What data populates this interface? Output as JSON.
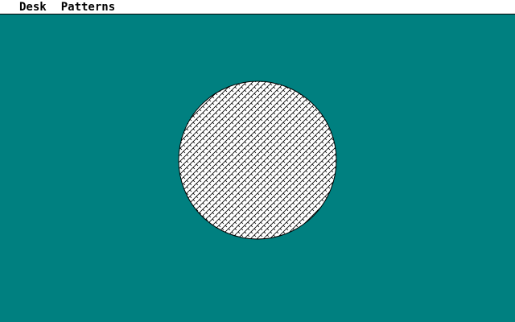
{
  "menubar": {
    "items": [
      {
        "label": "Desk"
      },
      {
        "label": "Patterns"
      }
    ]
  },
  "desktop": {
    "color": "#008080"
  },
  "shape": {
    "type": "circle",
    "fill_pattern": "diagonal-brick-hatch",
    "fill_color": "#ffffff",
    "stroke_color": "#000000"
  }
}
